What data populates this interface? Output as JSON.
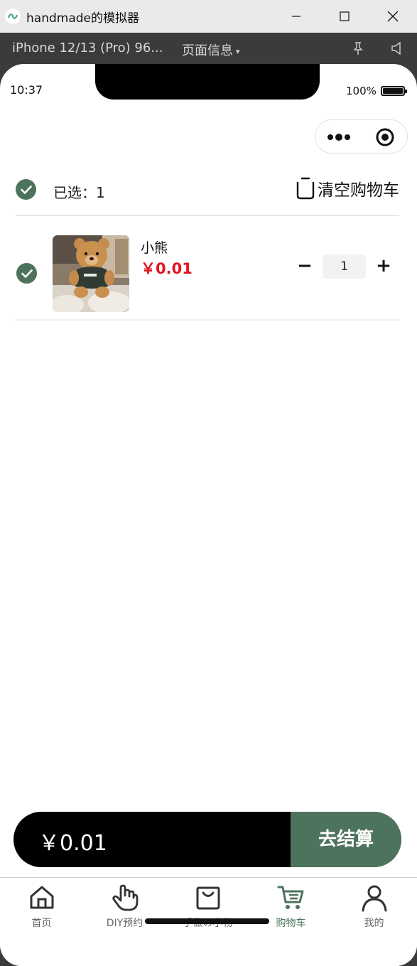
{
  "window": {
    "title": "handmade的模拟器"
  },
  "simulator": {
    "device": "iPhone 12/13 (Pro) 96...",
    "page_info": "页面信息",
    "page_info_caret": "▾"
  },
  "status_bar": {
    "time": "10:37",
    "battery": "100%"
  },
  "cart": {
    "selected_label": "已选：1",
    "clear_label": "清空购物车",
    "items": [
      {
        "name": "小熊",
        "price": "￥0.01",
        "quantity": "1",
        "minus": "−",
        "plus": "+",
        "checked": true
      }
    ]
  },
  "checkout": {
    "total": "￥0.01",
    "button_label": "去结算"
  },
  "tabbar": {
    "tabs": [
      {
        "label": "首页",
        "icon": "home-icon"
      },
      {
        "label": "DIY预约",
        "icon": "hand-icon"
      },
      {
        "label": "手做の小物",
        "icon": "bag-icon"
      },
      {
        "label": "购物车",
        "icon": "cart-icon",
        "active": true
      },
      {
        "label": "我的",
        "icon": "user-icon"
      }
    ]
  },
  "colors": {
    "accent": "#4e735c",
    "price": "#e0141e",
    "checkout_bar": "#000000"
  }
}
